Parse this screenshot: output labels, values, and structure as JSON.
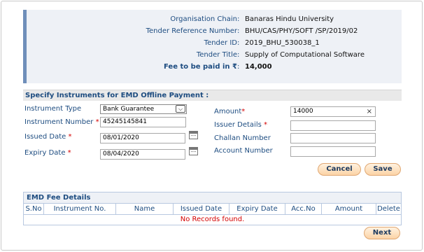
{
  "tender": {
    "rows": [
      {
        "label": "Organisation Chain",
        "value": "Banaras Hindu University"
      },
      {
        "label": "Tender Reference Number",
        "value": "BHU/CAS/PHY/SOFT /SP/2019/02"
      },
      {
        "label": "Tender ID",
        "value": "2019_BHU_530038_1"
      },
      {
        "label": "Tender Title",
        "value": "Supply of Computational Software"
      },
      {
        "label": "Fee to be paid in ₹",
        "value": "14,000"
      }
    ]
  },
  "emd": {
    "heading": "Specify Instruments for EMD Offline Payment :",
    "instrument_type": {
      "label": "Instrument Type",
      "value": "Bank Guarantee"
    },
    "instrument_number": {
      "label": "Instrument Number",
      "value": "45245145841"
    },
    "issued_date": {
      "label": "Issued Date",
      "value": "08/01/2020"
    },
    "expiry_date": {
      "label": "Expiry Date",
      "value": "08/04/2020"
    },
    "amount": {
      "label": "Amount",
      "value": "14000"
    },
    "issuer_details": {
      "label": "Issuer Details",
      "value": ""
    },
    "challan_number": {
      "label": "Challan Number",
      "value": ""
    },
    "account_number": {
      "label": "Account Number",
      "value": ""
    },
    "required_mark": "*",
    "cancel_label": "Cancel",
    "save_label": "Save"
  },
  "fee_details": {
    "heading": "EMD Fee Details",
    "columns": [
      "S.No",
      "Instrument No.",
      "Name",
      "Issued Date",
      "Expiry Date",
      "Acc.No",
      "Amount",
      "Delete"
    ],
    "empty_message": "No Records found."
  },
  "next_label": "Next",
  "colors": {
    "accent": "#1d4c80",
    "required": "#d40000",
    "button": "#fcd3a6"
  }
}
